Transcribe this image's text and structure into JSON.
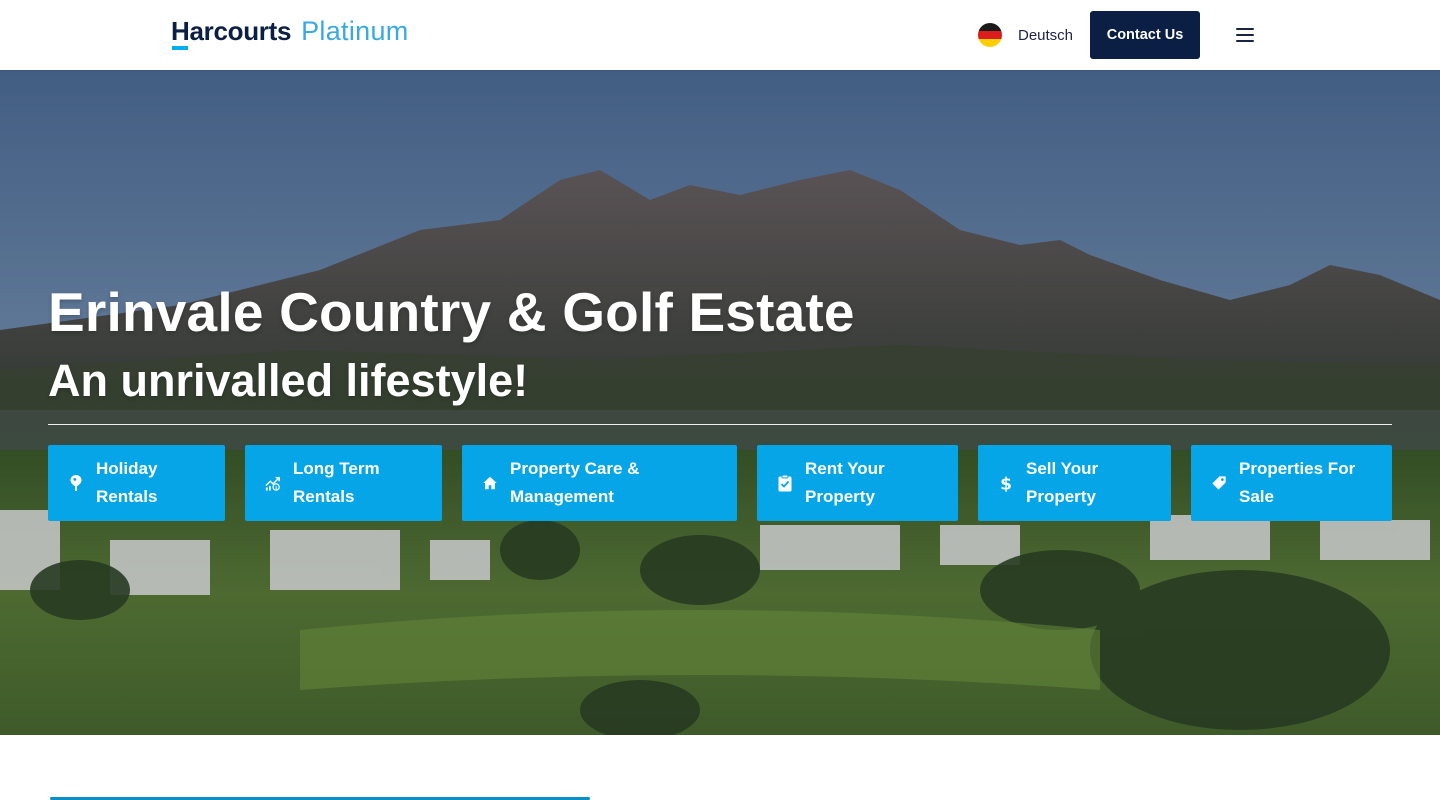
{
  "header": {
    "logo_main": "Harcourts",
    "logo_sub": "Platinum",
    "language_label": "Deutsch",
    "language_flag_icon": "german-flag-icon",
    "contact_label": "Contact Us",
    "menu_icon": "hamburger-menu-icon"
  },
  "hero": {
    "title": "Erinvale Country & Golf Estate",
    "subtitle": "An unrivalled lifestyle!"
  },
  "quick_links": [
    {
      "label": "Holiday Rentals",
      "icon": "map-pin-icon"
    },
    {
      "label": "Long Term Rentals",
      "icon": "growth-chart-icon"
    },
    {
      "label": "Property Care & Management",
      "icon": "home-icon"
    },
    {
      "label": "Rent Your Property",
      "icon": "clipboard-check-icon"
    },
    {
      "label": "Sell Your Property",
      "icon": "dollar-icon"
    },
    {
      "label": "Properties For Sale",
      "icon": "price-tag-icon"
    }
  ],
  "colors": {
    "brand_navy": "#0b1f44",
    "brand_cyan": "#00adef",
    "quick_link_bg": "#05a5e8"
  }
}
